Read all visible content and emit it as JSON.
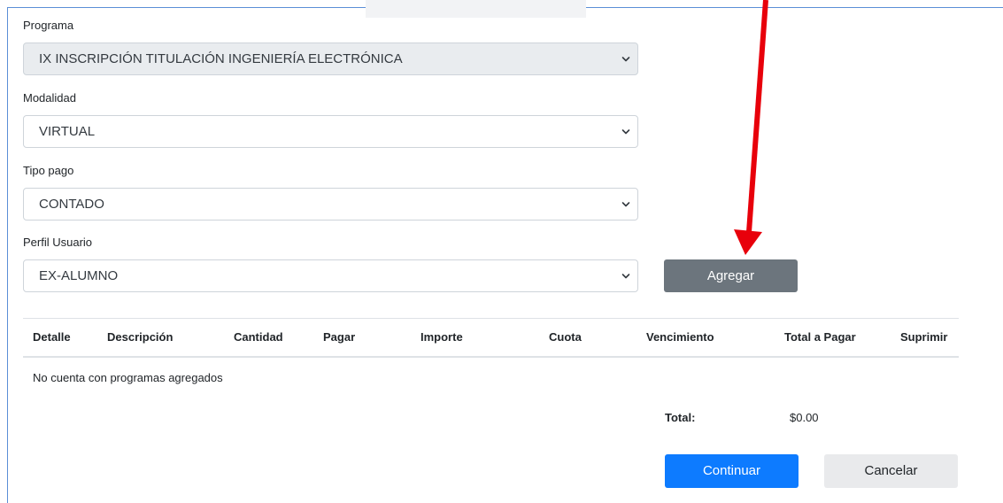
{
  "form": {
    "programa": {
      "label": "Programa",
      "value": "IX INSCRIPCIÓN TITULACIÓN INGENIERÍA ELECTRÓNICA"
    },
    "modalidad": {
      "label": "Modalidad",
      "value": "VIRTUAL"
    },
    "tipo_pago": {
      "label": "Tipo pago",
      "value": "CONTADO"
    },
    "perfil_usuario": {
      "label": "Perfil Usuario",
      "value": "EX-ALUMNO"
    },
    "add_label": "Agregar"
  },
  "table": {
    "columns": [
      "Detalle",
      "Descripción",
      "Cantidad",
      "Pagar",
      "Importe",
      "Cuota",
      "Vencimiento",
      "Total a Pagar",
      "Suprimir"
    ],
    "empty_message": "No cuenta con programas agregados"
  },
  "summary": {
    "total_label": "Total:",
    "total_value": "$0.00"
  },
  "actions": {
    "continue_label": "Continuar",
    "cancel_label": "Cancelar"
  },
  "colors": {
    "primary": "#0d7bff",
    "secondary": "#6c757d",
    "annotation_arrow": "#e8000b"
  },
  "icons": {
    "select_indicator": "chevron-down-icon",
    "annotation": "red-arrow-annotation"
  }
}
